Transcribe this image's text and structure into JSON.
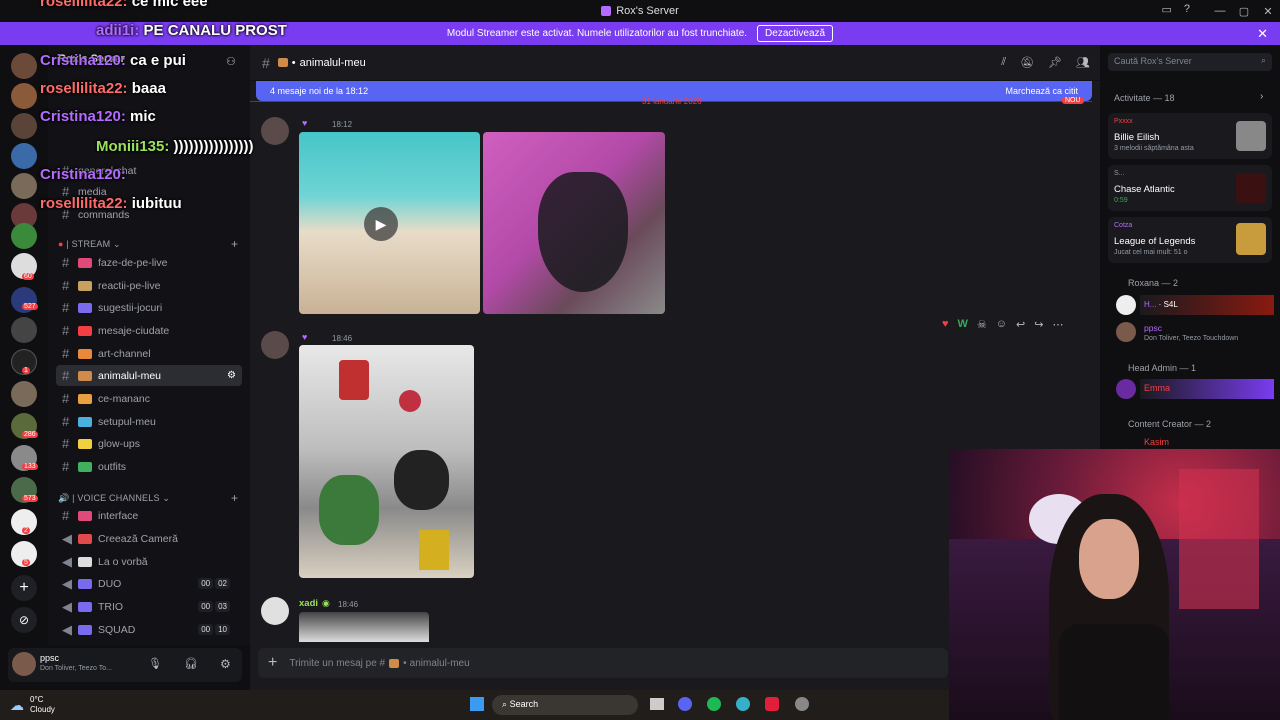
{
  "window": {
    "title": "Rox's Server"
  },
  "banner": {
    "text": "Modul Streamer este activat. Numele utilizatorilor au fost trunchiate.",
    "button": "Dezactivează"
  },
  "rail": {
    "badges": [
      "278",
      "60",
      "527",
      "1",
      "286",
      "133",
      "573",
      "2",
      "5"
    ]
  },
  "sidebar": {
    "server_name": "Rox's Server",
    "partial_channels": [
      "general-chat",
      "media",
      "commands"
    ],
    "stream_category": "| STREAM",
    "stream_channels": [
      "faze-de-pe-live",
      "reactii-pe-live",
      "sugestii-jocuri",
      "mesaje-ciudate",
      "art-channel",
      "animalul-meu",
      "ce-mananc",
      "setupul-meu",
      "glow-ups",
      "outfits"
    ],
    "voice_category": "| VOICE CHANNELS",
    "voice_channels": [
      {
        "name": "interface",
        "a": "",
        "b": ""
      },
      {
        "name": "Creează Cameră",
        "a": "",
        "b": ""
      },
      {
        "name": "La o vorbă",
        "a": "",
        "b": ""
      },
      {
        "name": "DUO",
        "a": "00",
        "b": "02"
      },
      {
        "name": "TRIO",
        "a": "00",
        "b": "03"
      },
      {
        "name": "SQUAD",
        "a": "00",
        "b": "10"
      }
    ]
  },
  "userpanel": {
    "name": "ppsc",
    "status": "Don Toliver, Teezo To..."
  },
  "main": {
    "channel": "animalul-meu",
    "new_messages": "4 mesaje noi de la 18:12",
    "mark_read": "Marchează ca citit",
    "date_divider": "31 ianuarie 2026",
    "new_tag": "NOU",
    "msg1_time": "18:12",
    "msg2_time": "18:46",
    "msg3_user": "xadi",
    "msg3_time": "18:46",
    "composer_placeholder": "Trimite un mesaj pe #",
    "composer_channel": "animalul-meu"
  },
  "right": {
    "search_placeholder": "Caută Rox's Server",
    "activity_title": "Activitate — 18",
    "activities": [
      {
        "user": "Pxxxx",
        "title": "Billie Eilish",
        "sub": "3 melodii săptămâna asta"
      },
      {
        "user": "S...",
        "title": "Chase Atlantic",
        "sub": "0:59"
      },
      {
        "user": "Cotza",
        "title": "League of Legends",
        "sub": "Jucat cel mai mult: 51 o"
      }
    ],
    "roxana": "Roxana — 2",
    "roxana_members": [
      {
        "name": "H...",
        "tag": "S4L"
      },
      {
        "name": "ppsc",
        "sub": "Don Toliver, Teezo Touchdown"
      }
    ],
    "headadmin": "Head Admin — 1",
    "headadmin_member": "Emma",
    "contentcreator": "Content Creator — 2",
    "cc_member": "Kasim"
  },
  "chat_overlay": [
    {
      "name": "rosellilita22:",
      "msg": "ce mic eee"
    },
    {
      "name": "adii1i:",
      "msg": "PE CANALU PROST"
    },
    {
      "name": "Cristina120:",
      "msg": "ca e pui"
    },
    {
      "name": "rosellilita22:",
      "msg": "baaa"
    },
    {
      "name": "Cristina120:",
      "msg": "mic"
    },
    {
      "name": "Moniii135:",
      "msg": "))))))))))))))))"
    },
    {
      "name": "Cristina120:",
      "msg": ""
    },
    {
      "name": "rosellilita22:",
      "msg": "iubituu"
    }
  ],
  "taskbar": {
    "temp": "0°C",
    "weather": "Cloudy",
    "search": "Search"
  },
  "colors": {
    "accent": "#5865f2",
    "banner": "#7a3cf0",
    "bg": "#1a1a1e"
  }
}
